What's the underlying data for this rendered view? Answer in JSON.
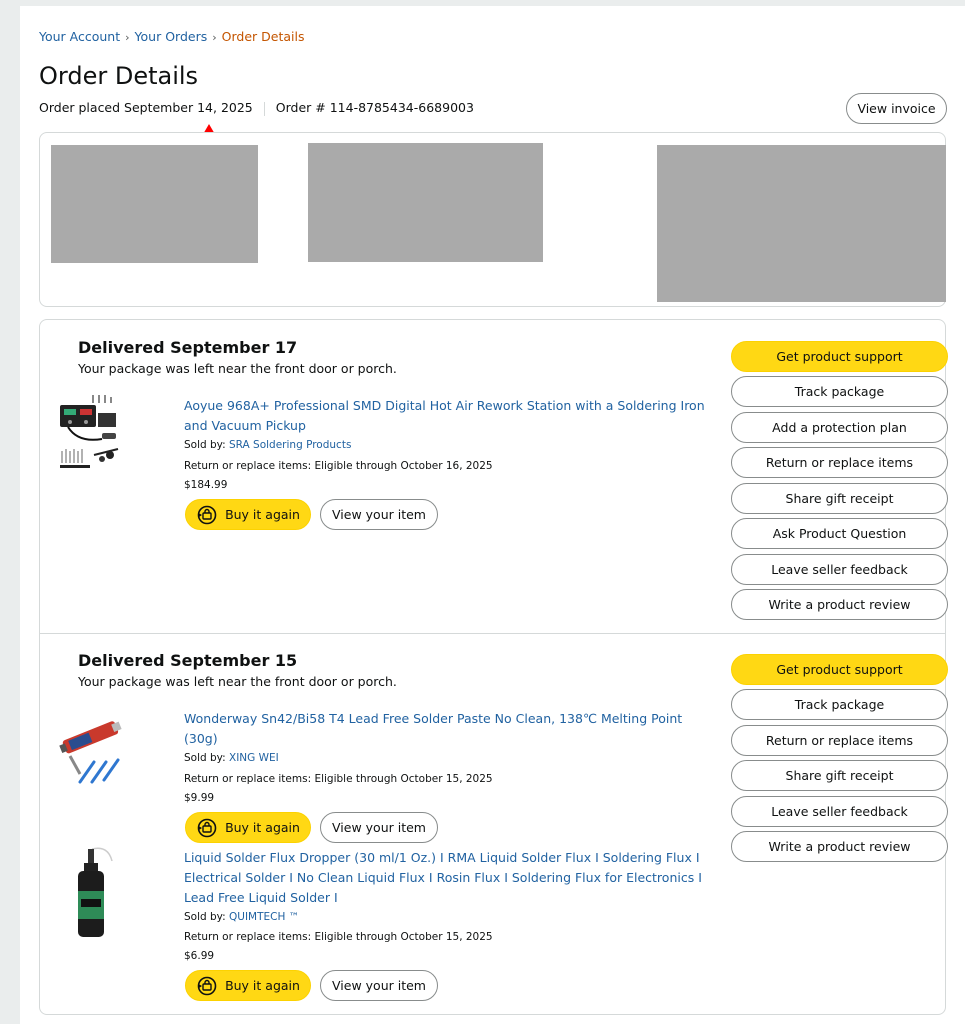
{
  "breadcrumb": {
    "items": [
      "Your Account",
      "Your Orders",
      "Order Details"
    ],
    "separator": "›"
  },
  "page_title": "Order Details",
  "order": {
    "placed_label": "Order placed September 14, 2025",
    "number_label": "Order # 114-8785434-6689003"
  },
  "view_invoice_label": "View invoice",
  "colors": {
    "accent_yellow": "#ffd814",
    "link": "#2162a1",
    "breadcrumb_current": "#c45500",
    "annotation_arrow": "#ff0000"
  },
  "shipments": [
    {
      "status": "Delivered September 17",
      "note": "Your package was left near the front door or porch.",
      "actions": [
        "Get product support",
        "Track package",
        "Add a protection plan",
        "Return or replace items",
        "Share gift receipt",
        "Ask Product Question",
        "Leave seller feedback",
        "Write a product review"
      ],
      "items": [
        {
          "title": "Aoyue 968A+ Professional SMD Digital Hot Air Rework Station with a Soldering Iron and Vacuum Pickup",
          "sold_by_label": "Sold by: ",
          "seller": "SRA Soldering Products",
          "return_info": "Return or replace items: Eligible through October 16, 2025",
          "price": "$184.99",
          "buy_again_label": "Buy it again",
          "view_item_label": "View your item"
        }
      ]
    },
    {
      "status": "Delivered September 15",
      "note": "Your package was left near the front door or porch.",
      "actions": [
        "Get product support",
        "Track package",
        "Return or replace items",
        "Share gift receipt",
        "Leave seller feedback",
        "Write a product review"
      ],
      "items": [
        {
          "title": "Wonderway Sn42/Bi58 T4 Lead Free Solder Paste No Clean, 138℃ Melting Point (30g)",
          "sold_by_label": "Sold by: ",
          "seller": "XING WEI",
          "return_info": "Return or replace items: Eligible through October 15, 2025",
          "price": "$9.99",
          "buy_again_label": "Buy it again",
          "view_item_label": "View your item"
        },
        {
          "title": "Liquid Solder Flux Dropper (30 ml/1 Oz.) I RMA Liquid Solder Flux I Soldering Flux I Electrical Solder I No Clean Liquid Flux I Rosin Flux I Soldering Flux for Electronics I Lead Free Liquid Solder I",
          "sold_by_label": "Sold by: ",
          "seller": "QUIMTECH ™",
          "return_info": "Return or replace items: Eligible through October 15, 2025",
          "price": "$6.99",
          "buy_again_label": "Buy it again",
          "view_item_label": "View your item"
        }
      ]
    }
  ]
}
